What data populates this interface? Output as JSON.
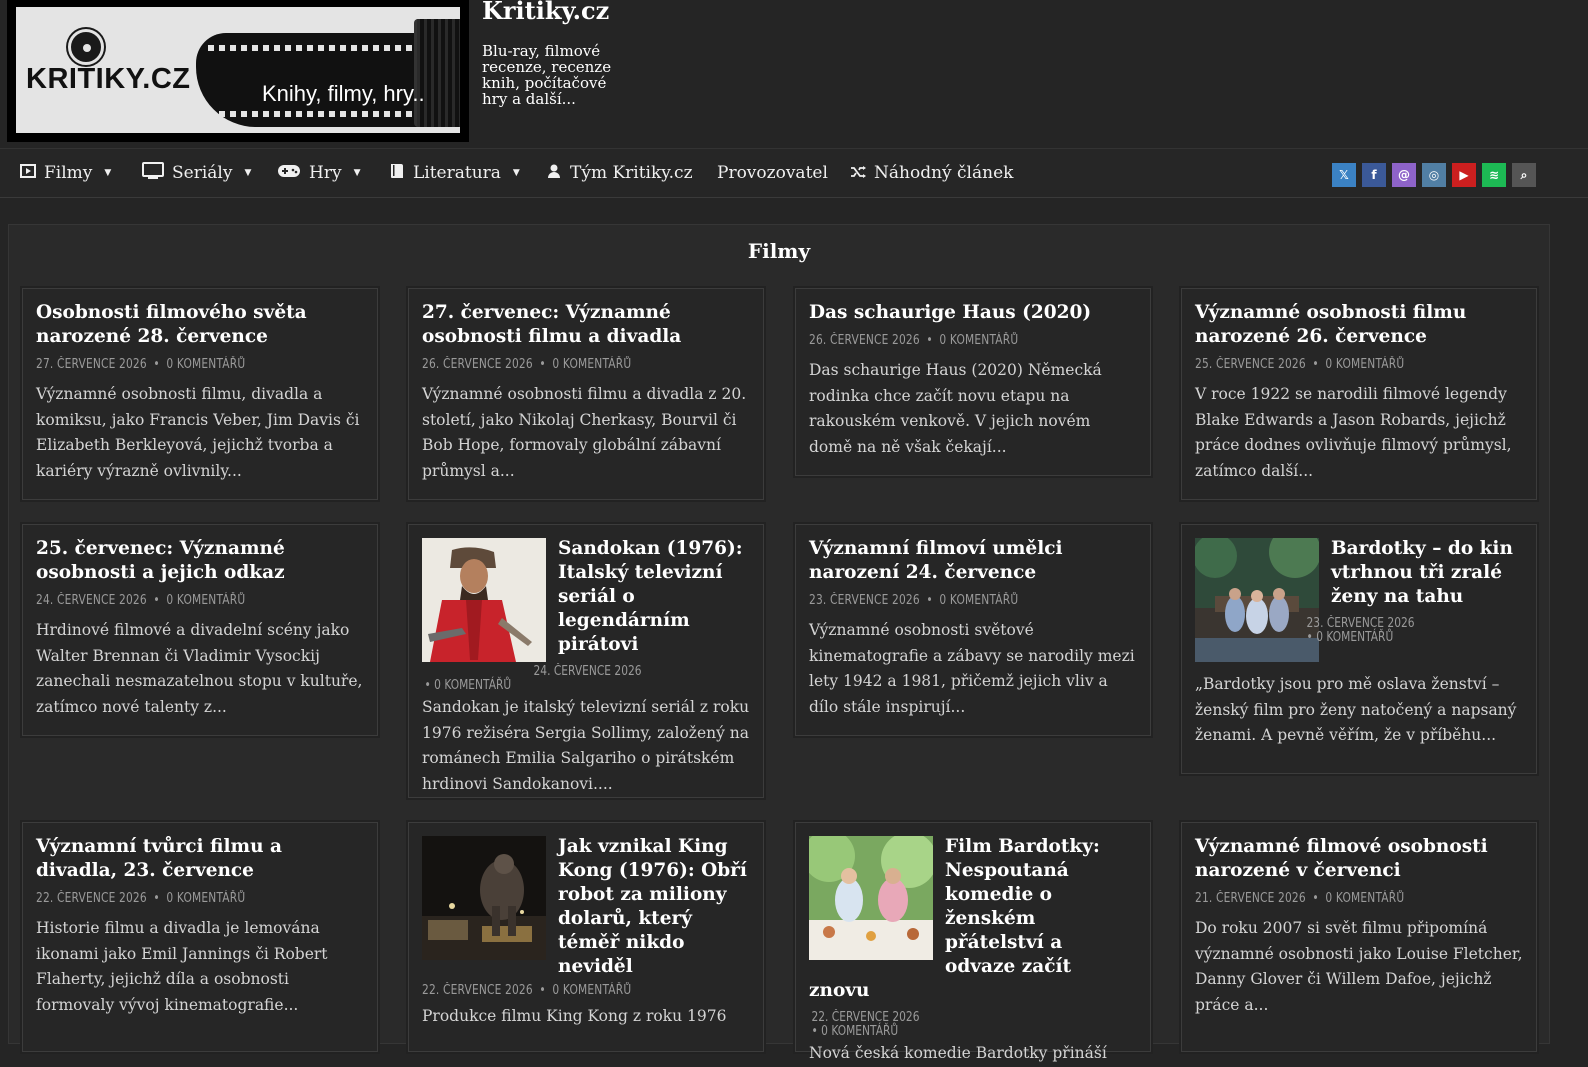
{
  "header": {
    "logo_text": "KRITIKY.CZ",
    "logo_slogan": "Knihy, filmy, hry..",
    "site_title": "Kritiky.cz",
    "site_description": "Blu-ray, filmové recenze, recenze knih, počítačové hry a další..."
  },
  "nav": {
    "items": [
      {
        "label": "Filmy",
        "icon": "film-icon",
        "has_dropdown": true
      },
      {
        "label": "Seriály",
        "icon": "tv-icon",
        "has_dropdown": true
      },
      {
        "label": "Hry",
        "icon": "gamepad-icon",
        "has_dropdown": true
      },
      {
        "label": "Literatura",
        "icon": "book-icon",
        "has_dropdown": true
      },
      {
        "label": "Tým Kritiky.cz",
        "icon": "user-icon",
        "has_dropdown": false
      },
      {
        "label": "Provozovatel",
        "icon": "",
        "has_dropdown": false
      },
      {
        "label": "Náhodný článek",
        "icon": "shuffle-icon",
        "has_dropdown": false
      }
    ],
    "social": [
      {
        "name": "x-icon",
        "glyph": "𝕏",
        "color": "#3b82c4"
      },
      {
        "name": "facebook-icon",
        "glyph": "f",
        "color": "#3b5998"
      },
      {
        "name": "threads-icon",
        "glyph": "@",
        "color": "#8e63c9"
      },
      {
        "name": "instagram-icon",
        "glyph": "◎",
        "color": "#517fa4"
      },
      {
        "name": "youtube-icon",
        "glyph": "▶",
        "color": "#cc1f1f"
      },
      {
        "name": "spotify-icon",
        "glyph": "≋",
        "color": "#1db954"
      },
      {
        "name": "search-icon",
        "glyph": "⌕",
        "color": "#555555"
      }
    ]
  },
  "section_title": "Filmy",
  "posts": [
    {
      "title": "Osobnosti filmového světa narozené 28. července",
      "date": "27. ČERVENCE 2026",
      "comments": "0 KOMENTÁŘŮ",
      "excerpt": "Významné osobnosti filmu, divadla a komiksu, jako Francis Veber, Jim Davis či Elizabeth Berkleyová, jejichž tvorba a kariéry výrazně ovlivnily..."
    },
    {
      "title": "27. červenec: Významné osobnosti filmu a divadla",
      "date": "26. ČERVENCE 2026",
      "comments": "0 KOMENTÁŘŮ",
      "excerpt": "Významné osobnosti filmu a divadla z 20. století, jako Nikolaj Cherkasy, Bourvil či Bob Hope, formovaly globální zábavní průmysl a..."
    },
    {
      "title": "Das schaurige Haus (2020)",
      "date": "26. ČERVENCE 2026",
      "comments": "0 KOMENTÁŘŮ",
      "excerpt": "Das schaurige Haus (2020) Německá rodinka chce začít novu etapu na rakouském venkově. V jejich novém domě na ně však čekají..."
    },
    {
      "title": "Významné osobnosti filmu narozené 26. července",
      "date": "25. ČERVENCE 2026",
      "comments": "0 KOMENTÁŘŮ",
      "excerpt": "V roce 1922 se narodili filmové legendy Blake Edwards a Jason Robards, jejichž práce dodnes ovlivňuje filmový průmysl, zatímco další..."
    },
    {
      "title": "25. červenec: Významné osobnosti a jejich odkaz",
      "date": "24. ČERVENCE 2026",
      "comments": "0 KOMENTÁŘŮ",
      "excerpt": "Hrdinové filmové a divadelní scény jako Walter Brennan či Vladimir Vysockij zanechali nesmazatelnou stopu v kultuře, zatímco nové talenty z..."
    },
    {
      "title": "Sandokan (1976): Italský televizní seriál o legendárním pirátovi",
      "date": "24. ČERVENCE 2026",
      "comments": "0 KOMENTÁŘŮ",
      "excerpt": "Sandokan je italský televizní seriál z roku 1976 režiséra Sergia Sollimy, založený na románech Emilia Salgariho o pirátském hrdinovi Sandokanovi...."
    },
    {
      "title": "Významní filmoví umělci narození 24. července",
      "date": "23. ČERVENCE 2026",
      "comments": "0 KOMENTÁŘŮ",
      "excerpt": "Významné osobnosti světové kinematografie a zábavy se narodily mezi lety 1942 a 1981, přičemž jejich vliv a dílo stále inspirují..."
    },
    {
      "title": "Bardotky – do kin vtrhnou tři zralé ženy na tahu",
      "date": "23. ČERVENCE 2026",
      "comments": "0 KOMENTÁŘŮ",
      "excerpt": "„Bardotky jsou pro mě oslava ženství – ženský film pro ženy natočený a napsaný ženami. A pevně věřím, že v příběhu..."
    },
    {
      "title": "Významní tvůrci filmu a divadla, 23. července",
      "date": "22. ČERVENCE 2026",
      "comments": "0 KOMENTÁŘŮ",
      "excerpt": "Historie filmu a divadla je lemována ikonami jako Emil Jannings či Robert Flaherty, jejichž díla a osobnosti formovaly vývoj kinematografie..."
    },
    {
      "title": "Jak vznikal King Kong (1976): Obří robot za miliony dolarů, který téměř nikdo neviděl",
      "date": "22. ČERVENCE 2026",
      "comments": "0 KOMENTÁŘŮ",
      "excerpt": "Produkce filmu King Kong z roku 1976"
    },
    {
      "title": "Film Bardotky: Nespoutaná komedie o ženském přátelství a odvaze začít znovu",
      "date": "22. ČERVENCE 2026",
      "comments": "0 KOMENTÁŘŮ",
      "excerpt": "Nová česká komedie Bardotky přináší"
    },
    {
      "title": "Významné filmové osobnosti narozené v červenci",
      "date": "21. ČERVENCE 2026",
      "comments": "0 KOMENTÁŘŮ",
      "excerpt": "Do roku 2007 si svět filmu připomíná významné osobnosti jako Louise Fletcher, Danny Glover či Willem Dafoe, jejichž práce a..."
    }
  ]
}
